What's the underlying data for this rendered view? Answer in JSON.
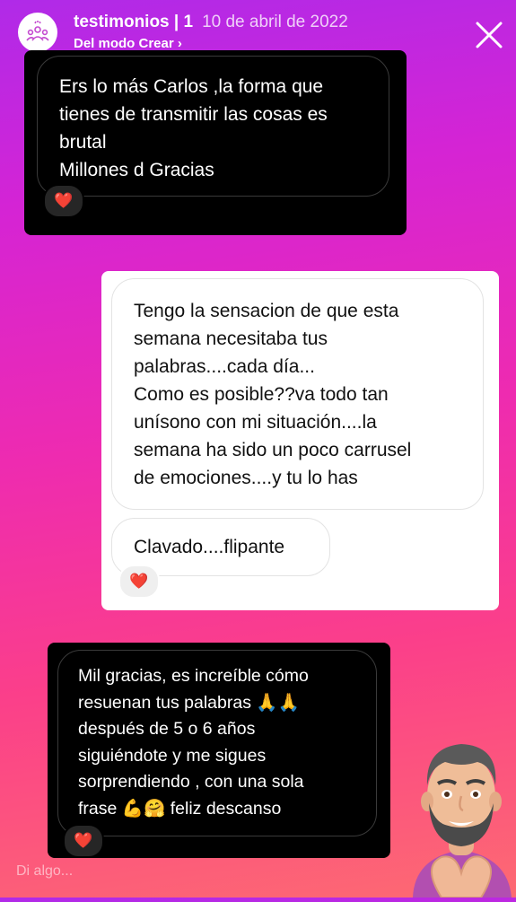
{
  "header": {
    "title": "testimonios | 1",
    "date": "10 de abril de 2022",
    "subtitle": "Del modo Crear ›",
    "avatar_icon": "testimonials-highlight-icon",
    "close_icon": "close-icon"
  },
  "messages": {
    "first": {
      "lines": [
        "Ers lo más Carlos ,la forma que",
        "tienes de transmitir las cosas es",
        "brutal",
        "Millones d Gracias"
      ],
      "reaction": "❤️"
    },
    "second": {
      "bubble1_lines": [
        "Tengo la sensacion de que esta",
        "semana necesitaba tus",
        "palabras....cada día...",
        "Como es posible??va todo tan",
        "unísono con mi situación....la",
        "semana ha sido un poco carrusel",
        "de emociones....y tu lo  has"
      ],
      "bubble2": "Clavado....flipante",
      "reaction": "❤️"
    },
    "third": {
      "lines": [
        "Mil gracias, es increíble cómo",
        "resuenan tus palabras 🙏🙏",
        "después de 5 o 6 años",
        "siguiéndote y me sigues",
        "sorprendiendo , con una sola",
        "frase 💪🤗  feliz descanso"
      ],
      "reaction": "❤️"
    }
  },
  "reply": {
    "placeholder": "Di algo..."
  },
  "colors": {
    "gradient_top": "#b02ae8",
    "gradient_bottom": "#fd6a72",
    "dark_card": "#000000",
    "light_card": "#ffffff"
  }
}
